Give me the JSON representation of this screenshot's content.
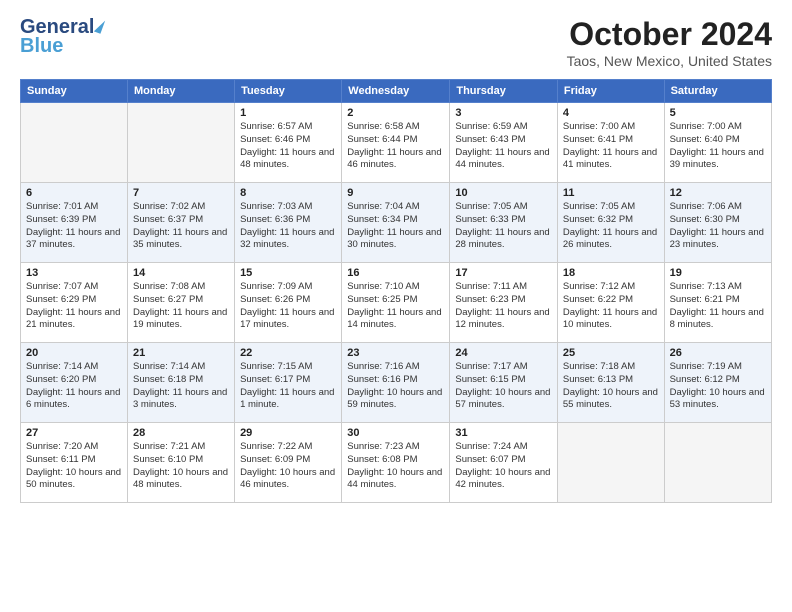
{
  "header": {
    "logo_line1": "General",
    "logo_line2": "Blue",
    "month_title": "October 2024",
    "location": "Taos, New Mexico, United States"
  },
  "weekdays": [
    "Sunday",
    "Monday",
    "Tuesday",
    "Wednesday",
    "Thursday",
    "Friday",
    "Saturday"
  ],
  "weeks": [
    [
      {
        "day": "",
        "info": ""
      },
      {
        "day": "",
        "info": ""
      },
      {
        "day": "1",
        "info": "Sunrise: 6:57 AM\nSunset: 6:46 PM\nDaylight: 11 hours and 48 minutes."
      },
      {
        "day": "2",
        "info": "Sunrise: 6:58 AM\nSunset: 6:44 PM\nDaylight: 11 hours and 46 minutes."
      },
      {
        "day": "3",
        "info": "Sunrise: 6:59 AM\nSunset: 6:43 PM\nDaylight: 11 hours and 44 minutes."
      },
      {
        "day": "4",
        "info": "Sunrise: 7:00 AM\nSunset: 6:41 PM\nDaylight: 11 hours and 41 minutes."
      },
      {
        "day": "5",
        "info": "Sunrise: 7:00 AM\nSunset: 6:40 PM\nDaylight: 11 hours and 39 minutes."
      }
    ],
    [
      {
        "day": "6",
        "info": "Sunrise: 7:01 AM\nSunset: 6:39 PM\nDaylight: 11 hours and 37 minutes."
      },
      {
        "day": "7",
        "info": "Sunrise: 7:02 AM\nSunset: 6:37 PM\nDaylight: 11 hours and 35 minutes."
      },
      {
        "day": "8",
        "info": "Sunrise: 7:03 AM\nSunset: 6:36 PM\nDaylight: 11 hours and 32 minutes."
      },
      {
        "day": "9",
        "info": "Sunrise: 7:04 AM\nSunset: 6:34 PM\nDaylight: 11 hours and 30 minutes."
      },
      {
        "day": "10",
        "info": "Sunrise: 7:05 AM\nSunset: 6:33 PM\nDaylight: 11 hours and 28 minutes."
      },
      {
        "day": "11",
        "info": "Sunrise: 7:05 AM\nSunset: 6:32 PM\nDaylight: 11 hours and 26 minutes."
      },
      {
        "day": "12",
        "info": "Sunrise: 7:06 AM\nSunset: 6:30 PM\nDaylight: 11 hours and 23 minutes."
      }
    ],
    [
      {
        "day": "13",
        "info": "Sunrise: 7:07 AM\nSunset: 6:29 PM\nDaylight: 11 hours and 21 minutes."
      },
      {
        "day": "14",
        "info": "Sunrise: 7:08 AM\nSunset: 6:27 PM\nDaylight: 11 hours and 19 minutes."
      },
      {
        "day": "15",
        "info": "Sunrise: 7:09 AM\nSunset: 6:26 PM\nDaylight: 11 hours and 17 minutes."
      },
      {
        "day": "16",
        "info": "Sunrise: 7:10 AM\nSunset: 6:25 PM\nDaylight: 11 hours and 14 minutes."
      },
      {
        "day": "17",
        "info": "Sunrise: 7:11 AM\nSunset: 6:23 PM\nDaylight: 11 hours and 12 minutes."
      },
      {
        "day": "18",
        "info": "Sunrise: 7:12 AM\nSunset: 6:22 PM\nDaylight: 11 hours and 10 minutes."
      },
      {
        "day": "19",
        "info": "Sunrise: 7:13 AM\nSunset: 6:21 PM\nDaylight: 11 hours and 8 minutes."
      }
    ],
    [
      {
        "day": "20",
        "info": "Sunrise: 7:14 AM\nSunset: 6:20 PM\nDaylight: 11 hours and 6 minutes."
      },
      {
        "day": "21",
        "info": "Sunrise: 7:14 AM\nSunset: 6:18 PM\nDaylight: 11 hours and 3 minutes."
      },
      {
        "day": "22",
        "info": "Sunrise: 7:15 AM\nSunset: 6:17 PM\nDaylight: 11 hours and 1 minute."
      },
      {
        "day": "23",
        "info": "Sunrise: 7:16 AM\nSunset: 6:16 PM\nDaylight: 10 hours and 59 minutes."
      },
      {
        "day": "24",
        "info": "Sunrise: 7:17 AM\nSunset: 6:15 PM\nDaylight: 10 hours and 57 minutes."
      },
      {
        "day": "25",
        "info": "Sunrise: 7:18 AM\nSunset: 6:13 PM\nDaylight: 10 hours and 55 minutes."
      },
      {
        "day": "26",
        "info": "Sunrise: 7:19 AM\nSunset: 6:12 PM\nDaylight: 10 hours and 53 minutes."
      }
    ],
    [
      {
        "day": "27",
        "info": "Sunrise: 7:20 AM\nSunset: 6:11 PM\nDaylight: 10 hours and 50 minutes."
      },
      {
        "day": "28",
        "info": "Sunrise: 7:21 AM\nSunset: 6:10 PM\nDaylight: 10 hours and 48 minutes."
      },
      {
        "day": "29",
        "info": "Sunrise: 7:22 AM\nSunset: 6:09 PM\nDaylight: 10 hours and 46 minutes."
      },
      {
        "day": "30",
        "info": "Sunrise: 7:23 AM\nSunset: 6:08 PM\nDaylight: 10 hours and 44 minutes."
      },
      {
        "day": "31",
        "info": "Sunrise: 7:24 AM\nSunset: 6:07 PM\nDaylight: 10 hours and 42 minutes."
      },
      {
        "day": "",
        "info": ""
      },
      {
        "day": "",
        "info": ""
      }
    ]
  ]
}
